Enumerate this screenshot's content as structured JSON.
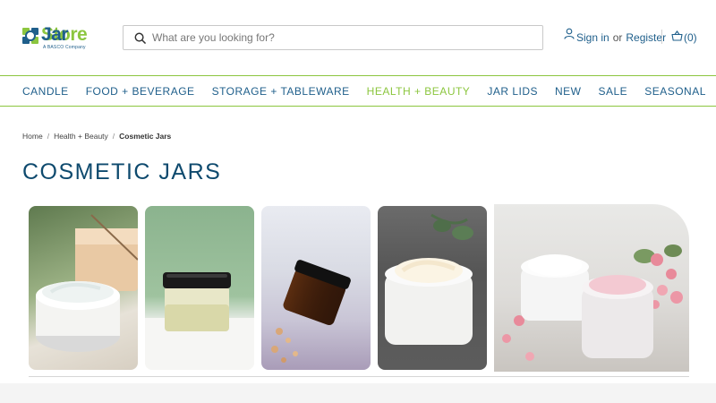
{
  "header": {
    "logo": {
      "name_part1": "Jar",
      "name_part2": "Store",
      "tagline": "A BASCO Company"
    },
    "search": {
      "placeholder": "What are you looking for?"
    },
    "account": {
      "sign_in": "Sign in",
      "or": "or",
      "register": "Register"
    },
    "cart": {
      "count_label": "(0)"
    }
  },
  "nav": {
    "items": [
      {
        "label": "CANDLE"
      },
      {
        "label": "FOOD + BEVERAGE"
      },
      {
        "label": "STORAGE + TABLEWARE"
      },
      {
        "label": "HEALTH + BEAUTY",
        "active": true
      },
      {
        "label": "JAR LIDS"
      },
      {
        "label": "NEW"
      },
      {
        "label": "SALE"
      },
      {
        "label": "SEASONAL"
      }
    ]
  },
  "breadcrumb": {
    "items": [
      "Home",
      "Health + Beauty"
    ],
    "current": "Cosmetic Jars"
  },
  "page": {
    "title": "COSMETIC JARS"
  },
  "banner": {
    "tiles": [
      {
        "icon": "white-cream-jar-with-soap"
      },
      {
        "icon": "glass-jar-with-black-lid"
      },
      {
        "icon": "amber-jar-with-flowers"
      },
      {
        "icon": "white-cream-jar-dark-background"
      },
      {
        "icon": "two-cream-jars-with-flowers"
      }
    ]
  },
  "colors": {
    "brand_blue": "#1f5f8b",
    "brand_green": "#8cc63f",
    "title_blue": "#0e4a6e"
  }
}
